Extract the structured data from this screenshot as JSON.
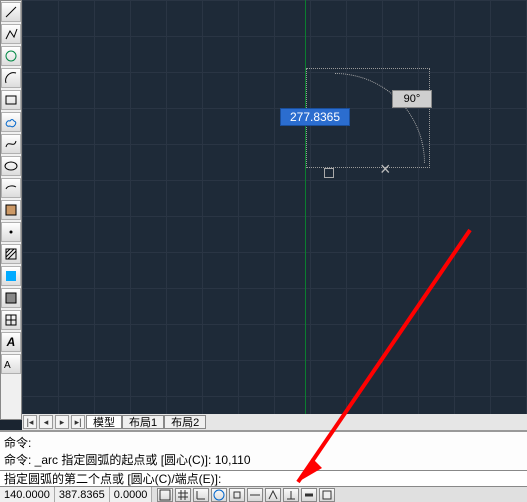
{
  "toolbar": {
    "tools": [
      "line-icon",
      "polyline-icon",
      "circle-icon",
      "arc-icon",
      "rectangle-icon",
      "revcloud-icon",
      "spline-icon",
      "ellipse-icon",
      "ellipse-arc-icon",
      "block-icon",
      "point-icon",
      "hatch-icon",
      "gradient-icon",
      "region-icon",
      "table-icon",
      "text-icon",
      "mtext-icon"
    ]
  },
  "canvas": {
    "distance_value": "277.8365",
    "angle_value": "90°",
    "endpoint_marker": "×"
  },
  "tabs": {
    "model": "模型",
    "layout1": "布局1",
    "layout2": "布局2"
  },
  "command": {
    "line1_prefix": "命令: ",
    "line2_prefix": "命令: ",
    "line2_cmd": "_arc ",
    "line2_prompt": "指定圆弧的起点或 [圆心(C)]: ",
    "line2_input_a": "1",
    "line2_input_b": "0,110",
    "current_prompt": "指定圆弧的第二个点或 [圆心(C)/端点(E)]:"
  },
  "status": {
    "coord_x": "140.0000",
    "coord_y": "387.8365",
    "coord_z": "0.0000"
  }
}
